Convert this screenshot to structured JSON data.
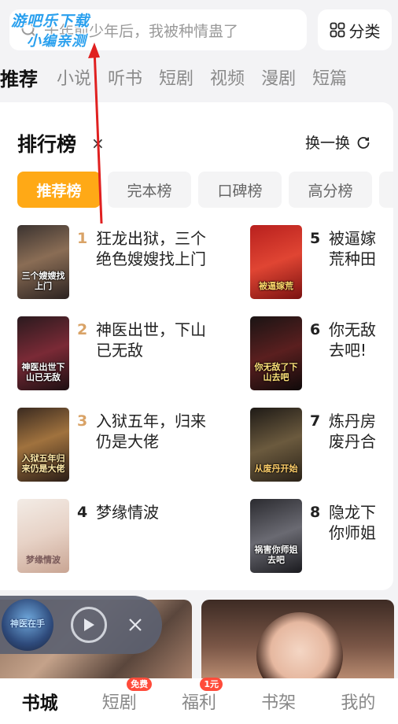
{
  "search": {
    "placeholder": "十年前少年后，我被种情蛊了",
    "category_label": "分类"
  },
  "watermark": {
    "line1": "游吧乐下载",
    "line2": "小编亲测"
  },
  "tabs": [
    "推荐",
    "小说",
    "听书",
    "短剧",
    "视频",
    "漫剧",
    "短篇"
  ],
  "ranking": {
    "title": "排行榜",
    "close_glyph": "×",
    "refresh_label": "换一换",
    "tabs": [
      "推荐榜",
      "完本榜",
      "口碑榜",
      "高分榜"
    ],
    "books": [
      {
        "rank": "1",
        "title": "狂龙出狱，三个\n绝色嫂嫂找上门",
        "cover_text": "三个嫂嫂找上门"
      },
      {
        "rank": "2",
        "title": "神医出世，下山\n已无敌",
        "cover_text": "神医出世下山已无敌"
      },
      {
        "rank": "3",
        "title": "入狱五年，归来\n仍是大佬",
        "cover_text": "入狱五年归来仍是大佬"
      },
      {
        "rank": "4",
        "title": "梦缘情波",
        "cover_text": "梦缘情波"
      },
      {
        "rank": "5",
        "title": "被逼嫁\n荒种田",
        "cover_text": "被逼嫁荒"
      },
      {
        "rank": "6",
        "title": "你无敌\n去吧!",
        "cover_text": "你无敌了下山去吧"
      },
      {
        "rank": "7",
        "title": "炼丹房\n废丹合",
        "cover_text": "从废丹开始"
      },
      {
        "rank": "8",
        "title": "隐龙下\n你师姐",
        "cover_text": "祸害你师姐去吧"
      }
    ],
    "rank_colors": {
      "top": "#d9a367",
      "normal": "#222222"
    }
  },
  "player": {
    "cover_text": "神医在手"
  },
  "bottom_nav": [
    {
      "label": "书城",
      "badge": ""
    },
    {
      "label": "短剧",
      "badge": "免费"
    },
    {
      "label": "福利",
      "badge": "1元"
    },
    {
      "label": "书架",
      "badge": ""
    },
    {
      "label": "我的",
      "badge": ""
    }
  ],
  "colors": {
    "accent": "#ffa916",
    "badge": "#ff4b3a"
  }
}
